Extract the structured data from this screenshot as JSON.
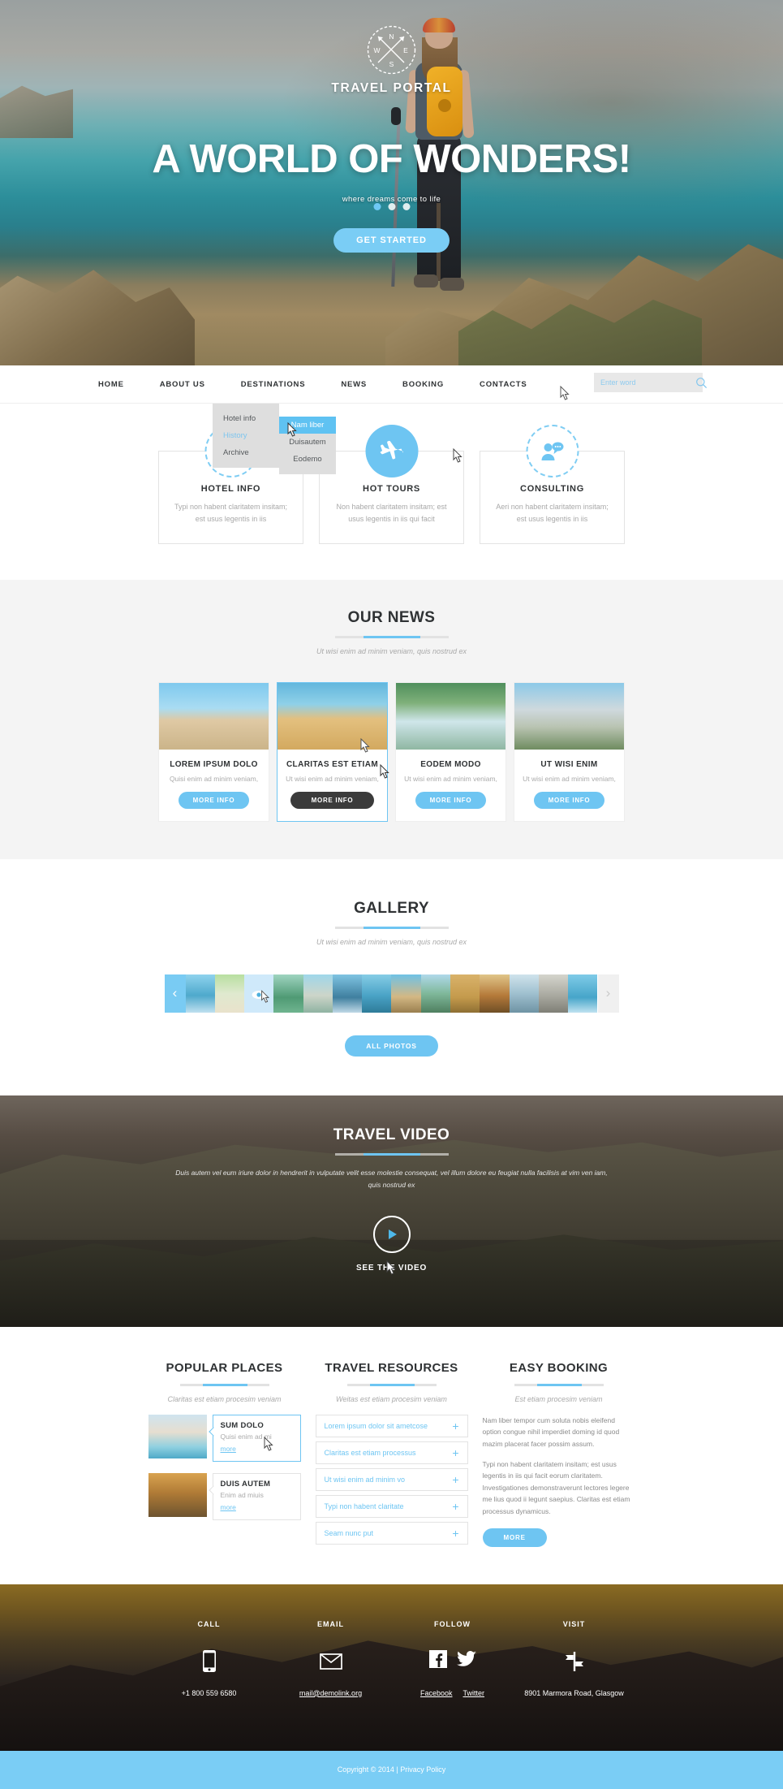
{
  "hero": {
    "brand": "TRAVEL PORTAL",
    "compass": {
      "n": "N",
      "w": "W",
      "e": "E",
      "s": "S"
    },
    "headline": "A WORLD OF WONDERS!",
    "subtitle": "where dreams come to life",
    "cta": "GET STARTED"
  },
  "nav": {
    "items": [
      {
        "label": "HOME"
      },
      {
        "label": "ABOUT US"
      },
      {
        "label": "DESTINATIONS"
      },
      {
        "label": "NEWS"
      },
      {
        "label": "BOOKING"
      },
      {
        "label": "CONTACTS"
      }
    ],
    "dropdown": [
      {
        "label": "Hotel info",
        "active": false
      },
      {
        "label": "History",
        "active": true
      },
      {
        "label": "Archive",
        "active": false
      }
    ],
    "submenu": [
      {
        "label": "Nam liber",
        "selected": true
      },
      {
        "label": "Duisautem",
        "selected": false
      },
      {
        "label": "Eodemo",
        "selected": false
      }
    ],
    "search": {
      "placeholder": "Enter word",
      "value": "",
      "icon": "search-icon"
    }
  },
  "services": [
    {
      "icon": "building-icon",
      "title": "HOTEL INFO",
      "text": "Typi non habent claritatem insitam; est usus legentis in iis",
      "filled": false
    },
    {
      "icon": "airplane-icon",
      "title": "HOT TOURS",
      "text": "Non habent claritatem insitam; est usus legentis in iis qui facit",
      "filled": true
    },
    {
      "icon": "consulting-icon",
      "title": "CONSULTING",
      "text": "Aeri non habent claritatem insitam; est usus legentis in iis",
      "filled": false
    }
  ],
  "news": {
    "title": "OUR NEWS",
    "subtitle": "Ut wisi enim ad minim veniam, quis nostrud ex",
    "cards": [
      {
        "title": "LOREM IPSUM DOLO",
        "text": "Quisi enim ad minim veniam,",
        "button": "MORE INFO",
        "hover": false
      },
      {
        "title": "CLARITAS EST ETIAM",
        "text": "Ut wisi enim ad minim veniam,",
        "button": "MORE INFO",
        "hover": true
      },
      {
        "title": "EODEM MODO",
        "text": "Ut wisi enim ad minim veniam,",
        "button": "MORE INFO",
        "hover": false
      },
      {
        "title": "UT WISI ENIM",
        "text": "Ut wisi enim ad minim veniam,",
        "button": "MORE INFO",
        "hover": false
      }
    ]
  },
  "gallery": {
    "title": "GALLERY",
    "subtitle": "Ut wisi enim ad minim veniam, quis nostrud ex",
    "prev_icon": "chevron-left-icon",
    "next_icon": "chevron-right-icon",
    "selected_index": 2,
    "thumb_count": 14,
    "button": "ALL PHOTOS"
  },
  "video": {
    "title": "TRAVEL VIDEO",
    "text": "Duis autem vel eum iriure dolor in hendrerit in vulputate velit esse molestie consequat, vel illum dolore eu feugiat nulla facilisis at vim ven iam, quis nostrud ex",
    "play_icon": "play-icon",
    "caption": "SEE THE VIDEO"
  },
  "popular_places": {
    "title": "POPULAR PLACES",
    "subtitle": "Claritas est etiam procesim veniam",
    "items": [
      {
        "title": "SUM DOLO",
        "text": "Quisi enim ad mi",
        "link": "more",
        "active": true
      },
      {
        "title": "DUIS AUTEM",
        "text": "Enim ad miuis",
        "link": "more",
        "active": false
      }
    ]
  },
  "travel_resources": {
    "title": "TRAVEL RESOURCES",
    "subtitle": "Weitas est etiam procesim veniam",
    "items": [
      {
        "label": "Lorem ipsum dolor sit ametcose",
        "icon": "plus-icon"
      },
      {
        "label": "Claritas est etiam processus",
        "icon": "plus-icon"
      },
      {
        "label": "Ut wisi enim ad minim vo",
        "icon": "plus-icon"
      },
      {
        "label": "Typi non habent claritate",
        "icon": "plus-icon"
      },
      {
        "label": "Seam nunc put",
        "icon": "plus-icon"
      }
    ]
  },
  "easy_booking": {
    "title": "EASY BOOKING",
    "subtitle": "Est etiam procesim veniam",
    "paragraph1": "Nam liber tempor cum soluta nobis eleifend option congue nihil imperdiet doming id quod mazim placerat facer possim assum.",
    "paragraph2": "Typi non habent claritatem insitam; est usus legentis in iis qui facit eorum claritatem. Investigationes demonstraverunt lectores legere me lius quod ii legunt saepius. Claritas est etiam processus dynamicus.",
    "button": "MORE"
  },
  "footer": {
    "columns": [
      {
        "heading": "CALL",
        "icon": "phone-icon",
        "value": "+1 800 559 6580"
      },
      {
        "heading": "EMAIL",
        "icon": "envelope-icon",
        "value": "mail@demolink.org"
      },
      {
        "heading": "FOLLOW",
        "icon": "social-icons",
        "links": [
          "Facebook",
          "Twitter"
        ]
      },
      {
        "heading": "VISIT",
        "icon": "signpost-icon",
        "value": "8901 Marmora Road, Glasgow"
      }
    ]
  },
  "copyright": "Copyright © 2014 | Privacy Policy",
  "colors": {
    "accent": "#6ec5f2",
    "accent_light": "#7acdf5",
    "dark": "#2f3234",
    "muted": "#a9a9a9",
    "news_bg": "#f4f4f4"
  }
}
